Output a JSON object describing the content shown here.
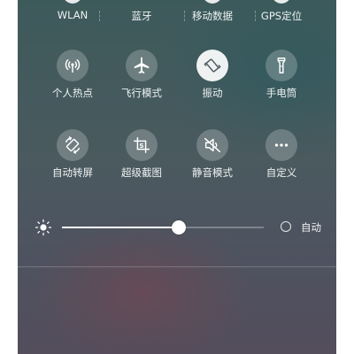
{
  "top_row": [
    {
      "label": "WLAN",
      "icon": "wifi-icon"
    },
    {
      "label": "蓝牙",
      "icon": "bluetooth-icon"
    },
    {
      "label": "移动数据",
      "icon": "mobile-data-icon"
    },
    {
      "label": "GPS定位",
      "icon": "gps-icon"
    }
  ],
  "tiles": [
    {
      "label": "个人热点",
      "icon": "hotspot-icon",
      "active": false
    },
    {
      "label": "飞行模式",
      "icon": "airplane-icon",
      "active": false
    },
    {
      "label": "振动",
      "icon": "vibrate-icon",
      "active": true
    },
    {
      "label": "手电筒",
      "icon": "flashlight-icon",
      "active": false
    },
    {
      "label": "自动转屏",
      "icon": "auto-rotate-icon",
      "active": false
    },
    {
      "label": "超级截图",
      "icon": "screenshot-icon",
      "active": false
    },
    {
      "label": "静音模式",
      "icon": "mute-icon",
      "active": false
    },
    {
      "label": "自定义",
      "icon": "more-icon",
      "active": false
    }
  ],
  "brightness": {
    "level": 0.58,
    "auto_label": "自动",
    "auto_enabled": false
  },
  "colors": {
    "active_tile": "#ffffff",
    "inactive_icon": "#ffffff",
    "active_icon": "#4a5a5f"
  }
}
